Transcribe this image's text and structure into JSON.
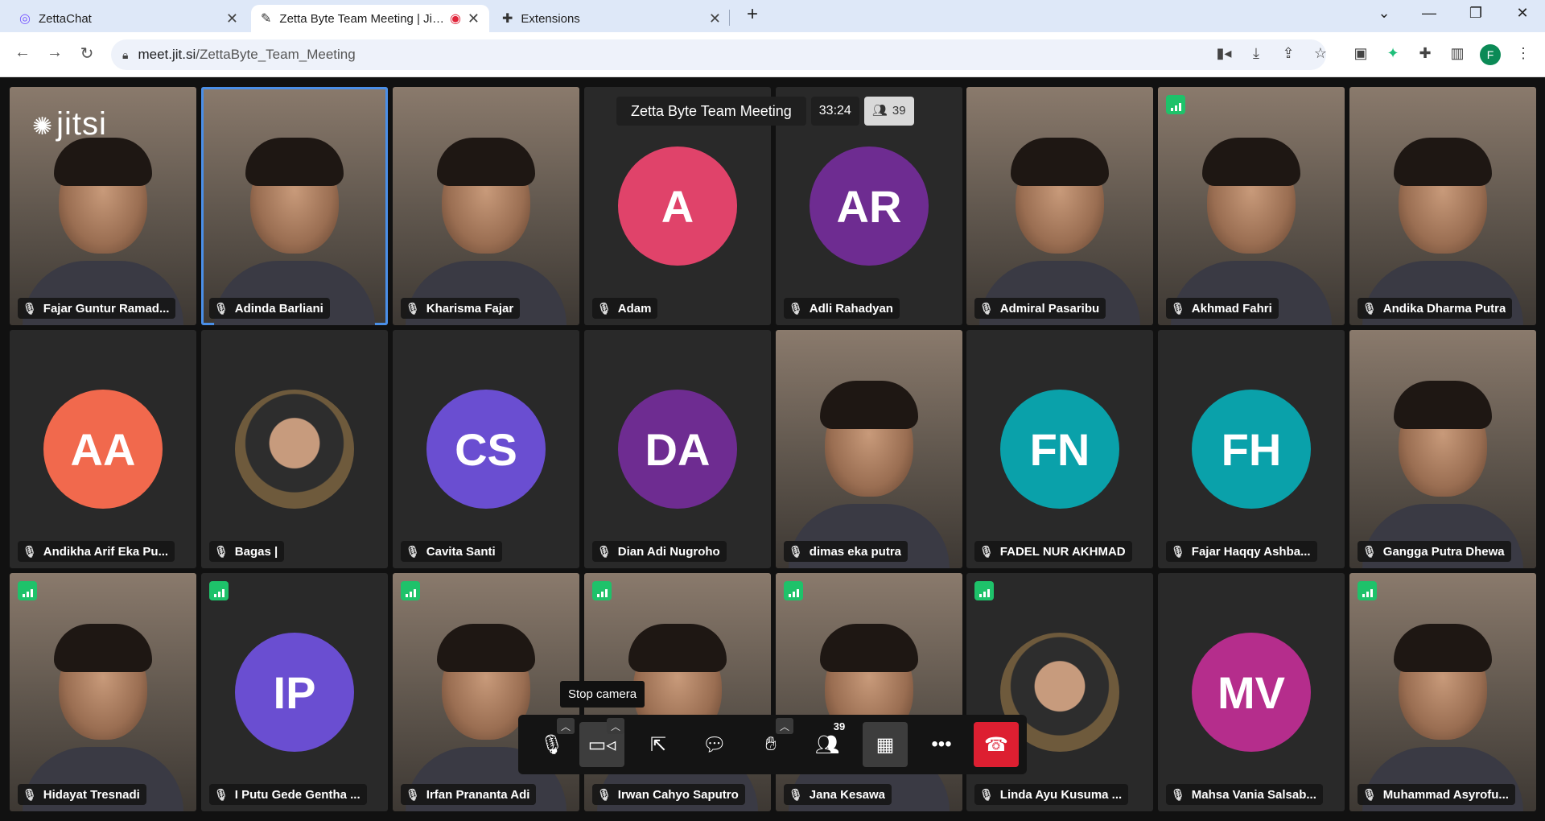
{
  "browser": {
    "tabs": [
      {
        "title": "ZettaChat"
      },
      {
        "title": "Zetta Byte Team Meeting | Jitsi Meet"
      },
      {
        "title": "Extensions"
      }
    ],
    "url_host": "meet.jit.si",
    "url_path": "/ZettaByte_Team_Meeting",
    "profile_initial": "F"
  },
  "meeting": {
    "logo": "jitsi",
    "title": "Zetta Byte Team Meeting",
    "duration": "33:24",
    "participant_count": "39"
  },
  "participants": [
    {
      "name": "Fajar Guntur Ramad...",
      "type": "video"
    },
    {
      "name": "Adinda Barliani",
      "type": "video",
      "speaking": true
    },
    {
      "name": "Kharisma Fajar",
      "type": "video"
    },
    {
      "name": "Adam",
      "type": "avatar",
      "initials": "A",
      "color": "#e0436a"
    },
    {
      "name": "Adli Rahadyan",
      "type": "avatar",
      "initials": "AR",
      "color": "#6e2c91"
    },
    {
      "name": "Admiral Pasaribu",
      "type": "video"
    },
    {
      "name": "Akhmad Fahri",
      "type": "video",
      "signal": true
    },
    {
      "name": "Andika Dharma Putra",
      "type": "video"
    },
    {
      "name": "Andikha Arif Eka Pu...",
      "type": "avatar",
      "initials": "AA",
      "color": "#f1694d"
    },
    {
      "name": "Bagas |",
      "type": "photo"
    },
    {
      "name": "Cavita Santi",
      "type": "avatar",
      "initials": "CS",
      "color": "#6a4ed1"
    },
    {
      "name": "Dian Adi Nugroho",
      "type": "avatar",
      "initials": "DA",
      "color": "#6e2c91"
    },
    {
      "name": "dimas eka putra",
      "type": "video"
    },
    {
      "name": "FADEL NUR AKHMAD",
      "type": "avatar",
      "initials": "FN",
      "color": "#0aa1aa"
    },
    {
      "name": "Fajar Haqqy Ashba...",
      "type": "avatar",
      "initials": "FH",
      "color": "#0aa1aa"
    },
    {
      "name": "Gangga Putra Dhewa",
      "type": "video"
    },
    {
      "name": "Hidayat Tresnadi",
      "type": "video",
      "signal": true
    },
    {
      "name": "I Putu Gede Gentha ...",
      "type": "avatar",
      "initials": "IP",
      "color": "#6a4ed1",
      "signal": true
    },
    {
      "name": "Irfan Prananta Adi",
      "type": "video",
      "signal": true
    },
    {
      "name": "Irwan Cahyo Saputro",
      "type": "video",
      "signal": true
    },
    {
      "name": "Jana Kesawa",
      "type": "video",
      "signal": true
    },
    {
      "name": "Linda Ayu Kusuma ...",
      "type": "photo",
      "signal": true
    },
    {
      "name": "Mahsa Vania Salsab...",
      "type": "avatar",
      "initials": "MV",
      "color": "#b52d8c"
    },
    {
      "name": "Muhammad Asyrofu...",
      "type": "video",
      "signal": true
    }
  ],
  "toolbar": {
    "tooltip": "Stop camera",
    "participants_badge": "39"
  }
}
